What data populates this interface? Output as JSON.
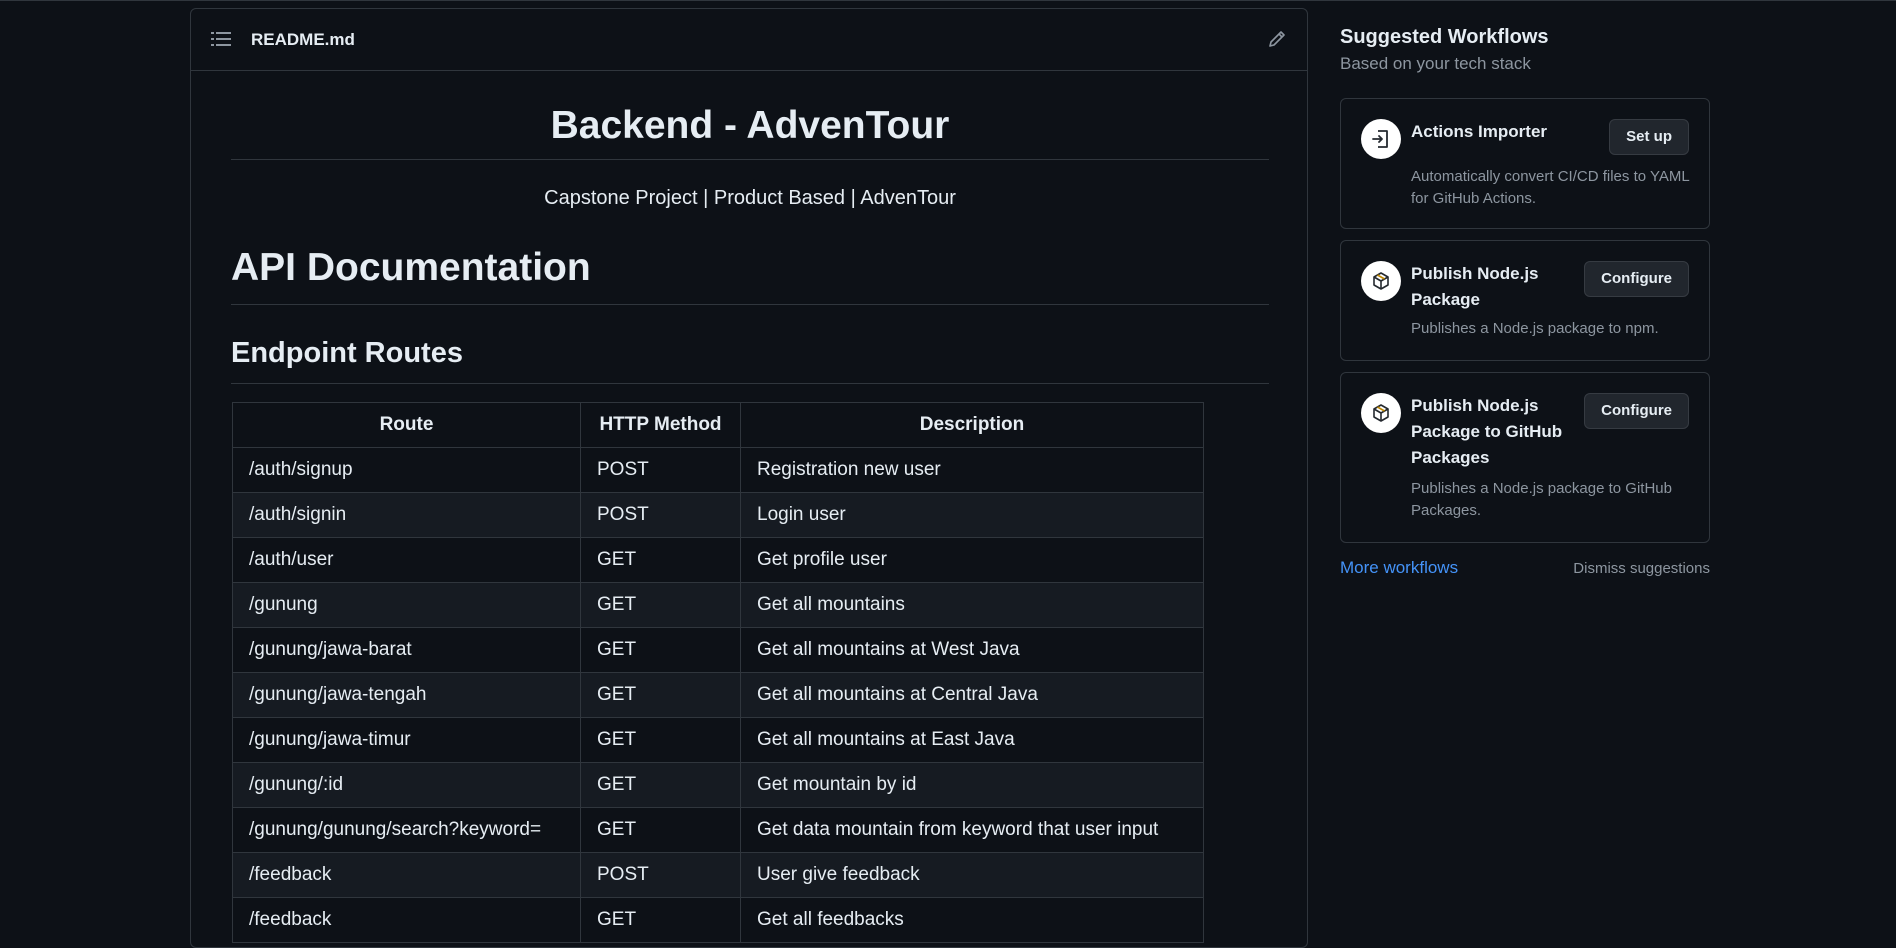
{
  "readme": {
    "filename": "README.md",
    "title": "Backend - AdvenTour",
    "subtitle": "Capstone Project | Product Based | AdvenTour",
    "h1": "API Documentation",
    "h2": "Endpoint Routes"
  },
  "table": {
    "headers": [
      "Route",
      "HTTP Method",
      "Description"
    ],
    "rows": [
      [
        "/auth/signup",
        "POST",
        "Registration new user"
      ],
      [
        "/auth/signin",
        "POST",
        "Login user"
      ],
      [
        "/auth/user",
        "GET",
        "Get profile user"
      ],
      [
        "/gunung",
        "GET",
        "Get all mountains"
      ],
      [
        "/gunung/jawa-barat",
        "GET",
        "Get all mountains at West Java"
      ],
      [
        "/gunung/jawa-tengah",
        "GET",
        "Get all mountains at Central Java"
      ],
      [
        "/gunung/jawa-timur",
        "GET",
        "Get all mountains at East Java"
      ],
      [
        "/gunung/:id",
        "GET",
        "Get mountain by id"
      ],
      [
        "/gunung/gunung/search?keyword=",
        "GET",
        "Get data mountain from keyword that user input"
      ],
      [
        "/feedback",
        "POST",
        "User give feedback"
      ],
      [
        "/feedback",
        "GET",
        "Get all feedbacks"
      ]
    ]
  },
  "sidebar": {
    "title": "Suggested Workflows",
    "subtitle": "Based on your tech stack",
    "cards": [
      {
        "name": "Actions Importer",
        "button": "Set up",
        "description": "Automatically convert CI/CD files to YAML for GitHub Actions.",
        "icon": "import-icon"
      },
      {
        "name": "Publish Node.js Package",
        "button": "Configure",
        "description": "Publishes a Node.js package to npm.",
        "icon": "package-icon"
      },
      {
        "name": "Publish Node.js Package to GitHub Packages",
        "button": "Configure",
        "description": "Publishes a Node.js package to GitHub Packages.",
        "icon": "package-icon"
      }
    ],
    "more_link": "More workflows",
    "dismiss": "Dismiss suggestions"
  },
  "colors": {
    "background": "#0d1117",
    "border": "#30363d",
    "text": "#e6edf3",
    "muted": "#8d96a0",
    "link": "#4493f8",
    "button": "#21262d"
  }
}
